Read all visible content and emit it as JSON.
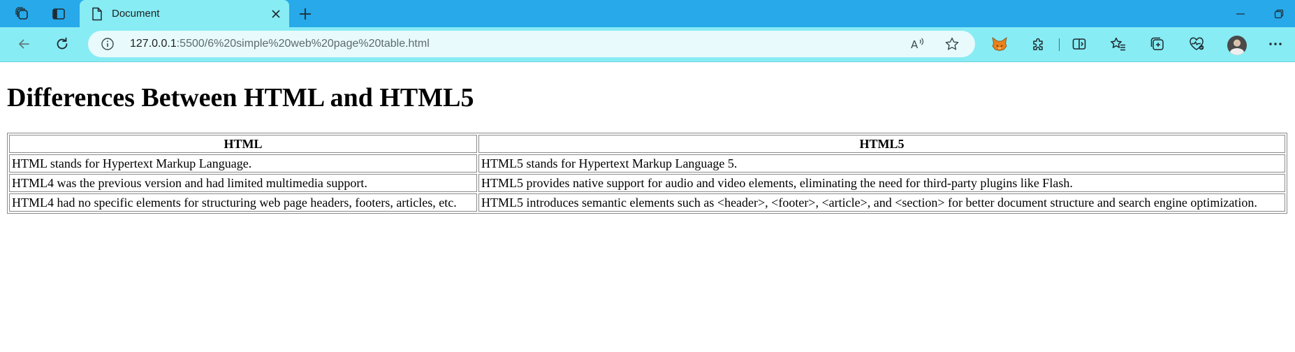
{
  "browser": {
    "tab": {
      "title": "Document"
    },
    "address_bar": {
      "host": "127.0.0.1",
      "path": ":5500/6%20simple%20web%20page%20table.html"
    },
    "icons": {
      "workspaces": "workspaces-icon",
      "tab_actions": "tab-actions-icon",
      "favicon": "document-icon",
      "close_tab": "close-icon",
      "new_tab": "plus-icon",
      "minimize": "minimize-icon",
      "restore": "restore-icon",
      "back": "back-arrow-icon",
      "refresh": "refresh-icon",
      "site_info": "info-icon",
      "read_aloud": "read-aloud-icon",
      "favorite": "star-icon",
      "extension_fox": "fox-extension-icon",
      "extensions": "puzzle-icon",
      "split_screen": "split-screen-icon",
      "favorites": "favorites-icon",
      "collections": "collections-icon",
      "browser_essentials": "heart-pulse-icon",
      "profile": "avatar",
      "more": "more-icon"
    },
    "colors": {
      "titlebar": "#27a9ea",
      "toolbar": "#87ecf4",
      "omnibox": "#e8fafc"
    }
  },
  "page": {
    "heading": "Differences Between HTML and HTML5",
    "table": {
      "headers": [
        "HTML",
        "HTML5"
      ],
      "rows": [
        [
          "HTML stands for Hypertext Markup Language.",
          "HTML5 stands for Hypertext Markup Language 5."
        ],
        [
          "HTML4 was the previous version and had limited multimedia support.",
          "HTML5 provides native support for audio and video elements, eliminating the need for third-party plugins like Flash."
        ],
        [
          "HTML4 had no specific elements for structuring web page headers, footers, articles, etc.",
          "HTML5 introduces semantic elements such as <header>, <footer>, <article>, and <section> for better document structure and search engine optimization."
        ]
      ]
    }
  }
}
